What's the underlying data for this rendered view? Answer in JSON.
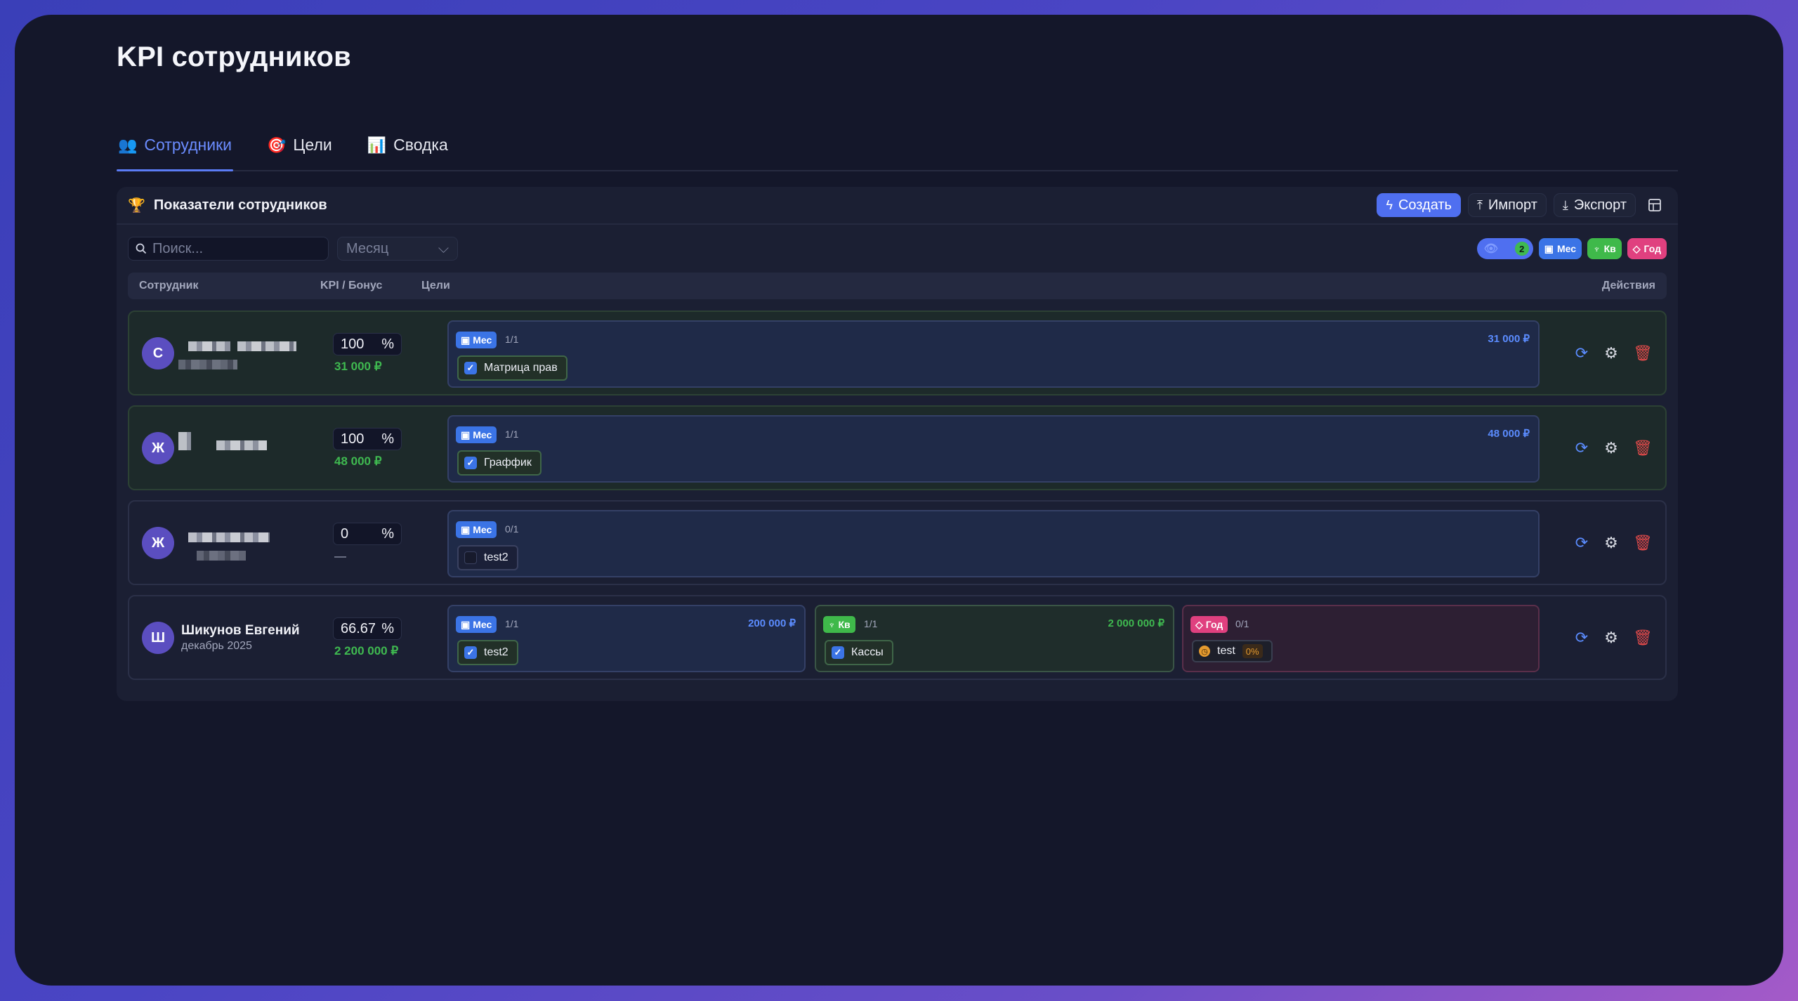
{
  "page": {
    "title": "KPI сотрудников"
  },
  "tabs": [
    {
      "icon": "👥",
      "label": "Сотрудники"
    },
    {
      "icon": "🎯",
      "label": "Цели"
    },
    {
      "icon": "📊",
      "label": "Сводка"
    }
  ],
  "panel": {
    "title": "Показатели сотрудников",
    "create_label": "Создать",
    "import_label": "Импорт",
    "export_label": "Экспорт"
  },
  "filters": {
    "search_placeholder": "Поиск...",
    "period_placeholder": "Месяц",
    "visible_count": "2",
    "chip_mes": "Мес",
    "chip_kv": "Кв",
    "chip_god": "Год"
  },
  "columns": {
    "employee": "Сотрудник",
    "kpi_bonus": "KPI / Бонус",
    "goals": "Цели",
    "actions": "Действия"
  },
  "colors": {
    "accent": "#4f6ff0",
    "month": "#3b74e6",
    "quarter": "#3fb94a",
    "year": "#e0407f",
    "bonus": "#3fb950",
    "danger": "#e04a4a"
  },
  "rows": [
    {
      "initial": "С",
      "name": "",
      "period": "",
      "kpi": "100",
      "bonus": "31 000 ₽",
      "goals": [
        {
          "tag": "Мес",
          "frac": "1/1",
          "amount": "31 000 ₽",
          "item": "Матрица прав",
          "done": true
        }
      ]
    },
    {
      "initial": "Ж",
      "name": "",
      "period": "",
      "kpi": "100",
      "bonus": "48 000 ₽",
      "goals": [
        {
          "tag": "Мес",
          "frac": "1/1",
          "amount": "48 000 ₽",
          "item": "Граффик",
          "done": true
        }
      ]
    },
    {
      "initial": "Ж",
      "name": "",
      "period": "",
      "kpi": "0",
      "bonus": "—",
      "goals": [
        {
          "tag": "Мес",
          "frac": "0/1",
          "amount": "",
          "item": "test2",
          "done": false
        }
      ]
    },
    {
      "initial": "Ш",
      "name": "Шикунов Евгений",
      "period": "декабрь 2025",
      "kpi": "66.67",
      "bonus": "2 200 000 ₽",
      "goals": [
        {
          "tag": "Мес",
          "frac": "1/1",
          "amount": "200 000 ₽",
          "item": "test2",
          "done": true
        },
        {
          "tag": "Кв",
          "frac": "1/1",
          "amount": "2 000 000 ₽",
          "item": "Кассы",
          "done": true
        },
        {
          "tag": "Год",
          "frac": "0/1",
          "amount": "",
          "item": "test",
          "done": false,
          "progress": "0%"
        }
      ]
    }
  ],
  "kpi_unit": "%"
}
